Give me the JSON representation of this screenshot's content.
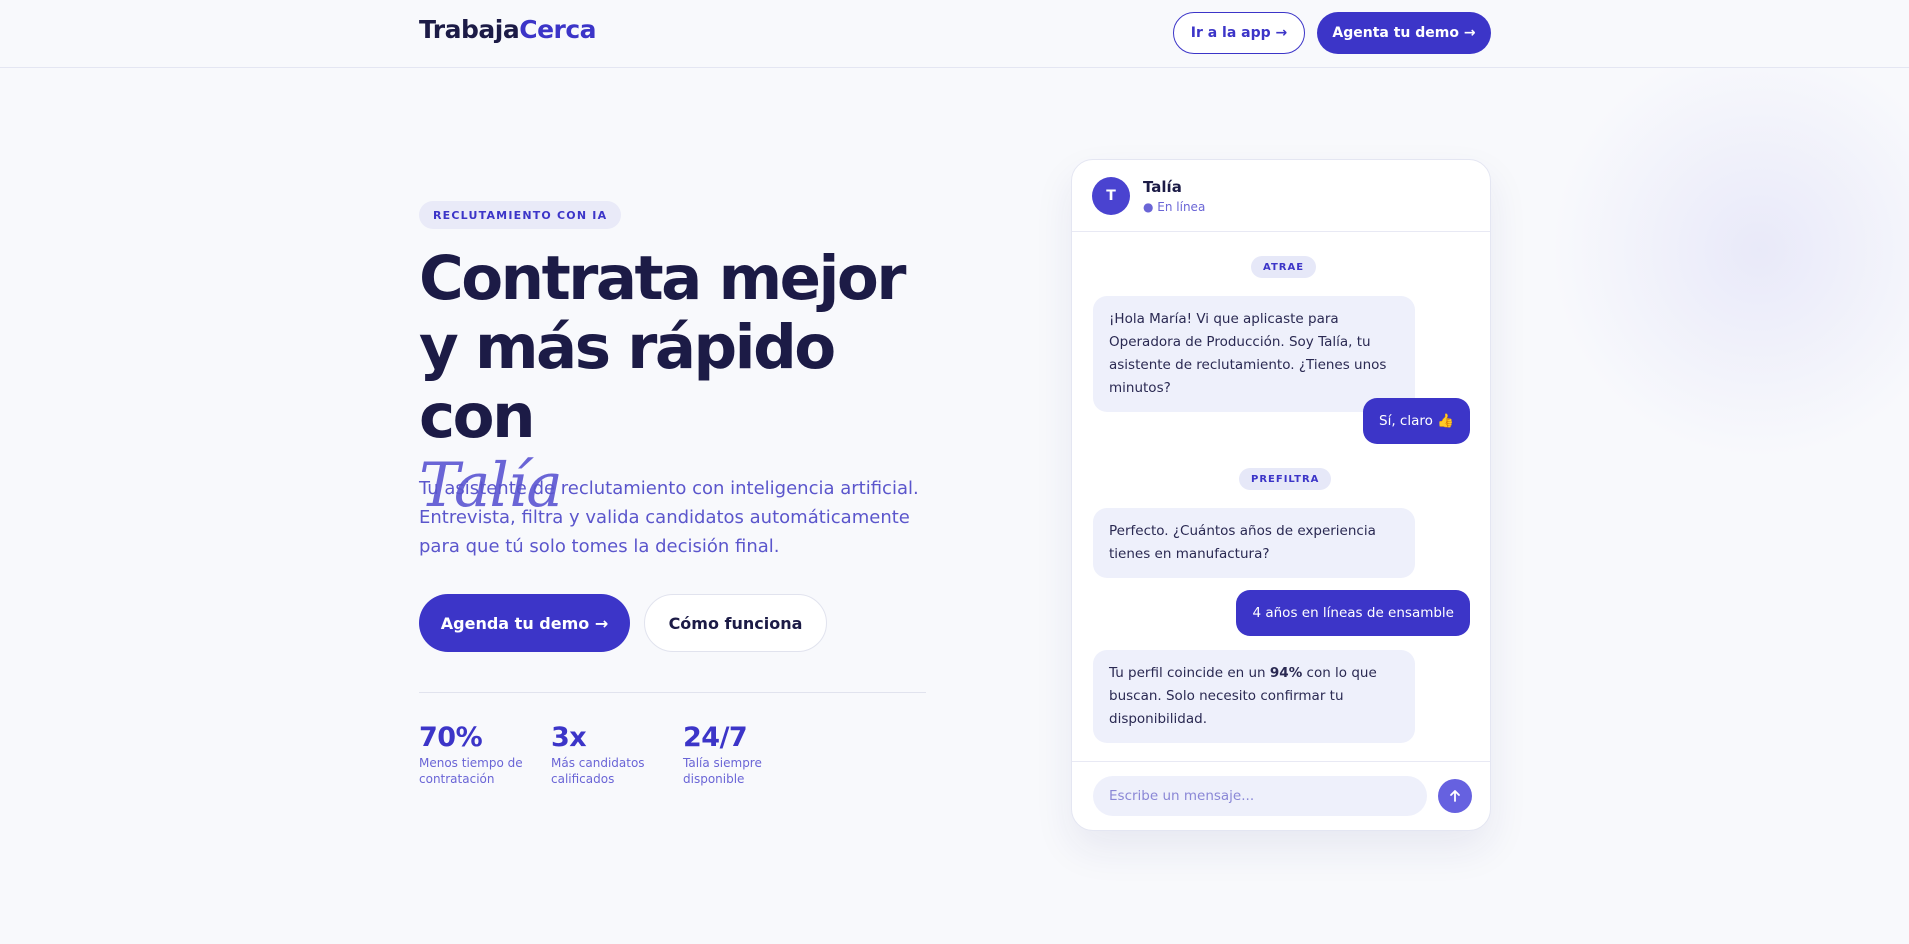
{
  "header": {
    "logo_part1": "Trabaja",
    "logo_part2": "Cerca",
    "app_button": "Ir a la app →",
    "demo_button": "Agenta tu demo →"
  },
  "hero": {
    "badge": "RECLUTAMIENTO CON IA",
    "title_line1": "Contrata mejor",
    "title_line2": "y más rápido con",
    "title_accent": "Talía",
    "subtitle": "Tu asistente de reclutamiento con inteligencia artificial. Entrevista, filtra y valida candidatos automáticamente para que tú solo tomes la decisión final.",
    "primary_button": "Agenda tu demo →",
    "secondary_button": "Cómo funciona",
    "stats": [
      {
        "value": "70%",
        "label": "Menos tiempo de contratación"
      },
      {
        "value": "3x",
        "label": "Más candidatos calificados"
      },
      {
        "value": "24/7",
        "label": "Talía siempre disponible"
      }
    ]
  },
  "chat": {
    "avatar_initial": "T",
    "agent_name": "Talía",
    "agent_status": "● En línea",
    "stage1": "ATRAE",
    "bot_msg1": "¡Hola María! Vi que aplicaste para Operadora de Producción. Soy Talía, tu asistente de reclutamiento. ¿Tienes unos minutos?",
    "user_msg1": "Sí, claro 👍",
    "stage2": "PREFILTRA",
    "bot_msg2": "Perfecto. ¿Cuántos años de experiencia tienes en manufactura?",
    "user_msg2": "4 años en líneas de ensamble",
    "bot_msg3_pre": "Tu perfil coincide en un ",
    "bot_msg3_bold": "94%",
    "bot_msg3_post": " con lo que buscan. Solo necesito confirmar tu disponibilidad.",
    "input_placeholder": "Escribe un mensaje...",
    "send_icon": "arrow-up-icon"
  },
  "colors": {
    "brand": "#3c35c8",
    "accent": "#6a65d6",
    "text_dark": "#1c1b46",
    "background": "#f8f9fc"
  }
}
